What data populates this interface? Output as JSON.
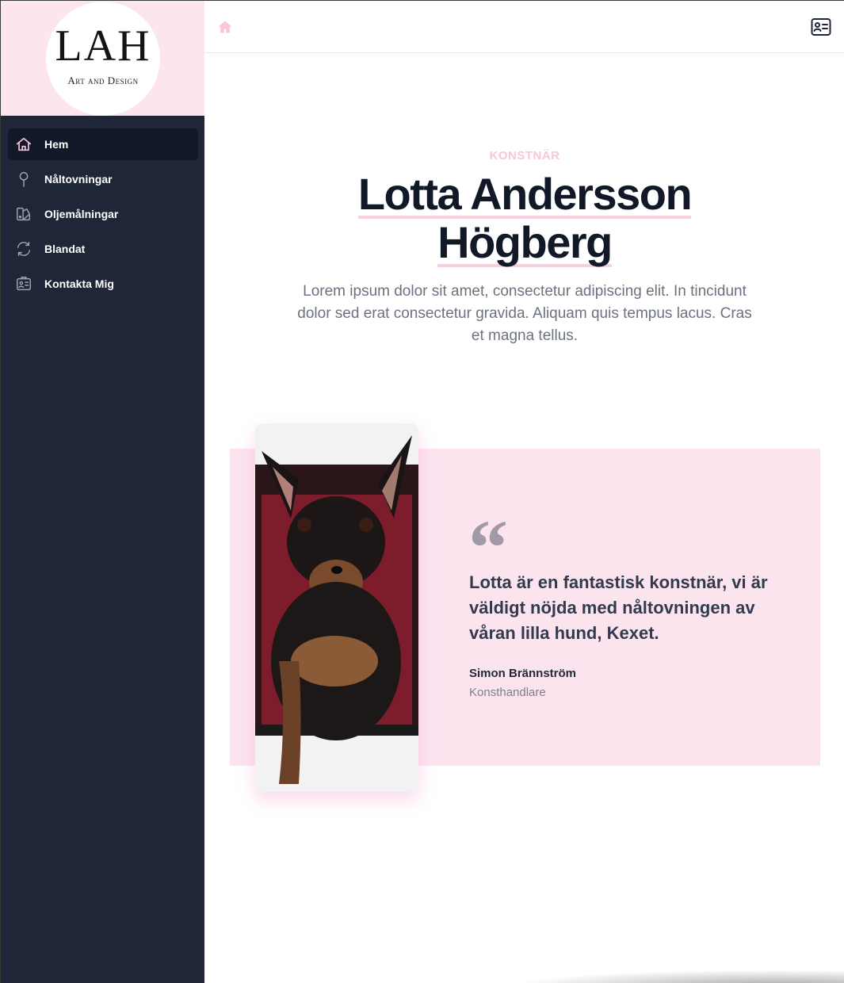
{
  "brand": {
    "logo_main": "LAH",
    "logo_sub": "Art and Design"
  },
  "sidebar": {
    "items": [
      {
        "label": "Hem",
        "icon": "home-icon",
        "active": true
      },
      {
        "label": "Nåltovningar",
        "icon": "pin-icon",
        "active": false
      },
      {
        "label": "Oljemålningar",
        "icon": "palette-icon",
        "active": false
      },
      {
        "label": "Blandat",
        "icon": "refresh-icon",
        "active": false
      },
      {
        "label": "Kontakta Mig",
        "icon": "contact-card-icon",
        "active": false
      }
    ]
  },
  "topbar": {
    "home_icon": "home-icon",
    "contact_icon": "contact-card-icon"
  },
  "hero": {
    "eyebrow": "KONSTNÄR",
    "title_line1": "Lotta Andersson",
    "title_line2": "Högberg",
    "lead": "Lorem ipsum dolor sit amet, consectetur adipiscing elit. In tincidunt dolor sed erat consectetur gravida. Aliquam quis tempus lacus. Cras et magna tellus."
  },
  "testimonial": {
    "quote_mark": "“",
    "quote": "Lotta är en fantastisk konstnär, vi är väldigt nöjda med nåltovningen av våran lilla hund, Kexet.",
    "author": "Simon Brännström",
    "role": "Konsthandlare",
    "image": "felted-dog-sculpture"
  },
  "colors": {
    "sidebar_bg": "#1f2637",
    "accent_pink": "#f9c5dc",
    "testimonial_bg": "#fce4ef",
    "title_text": "#111827"
  }
}
